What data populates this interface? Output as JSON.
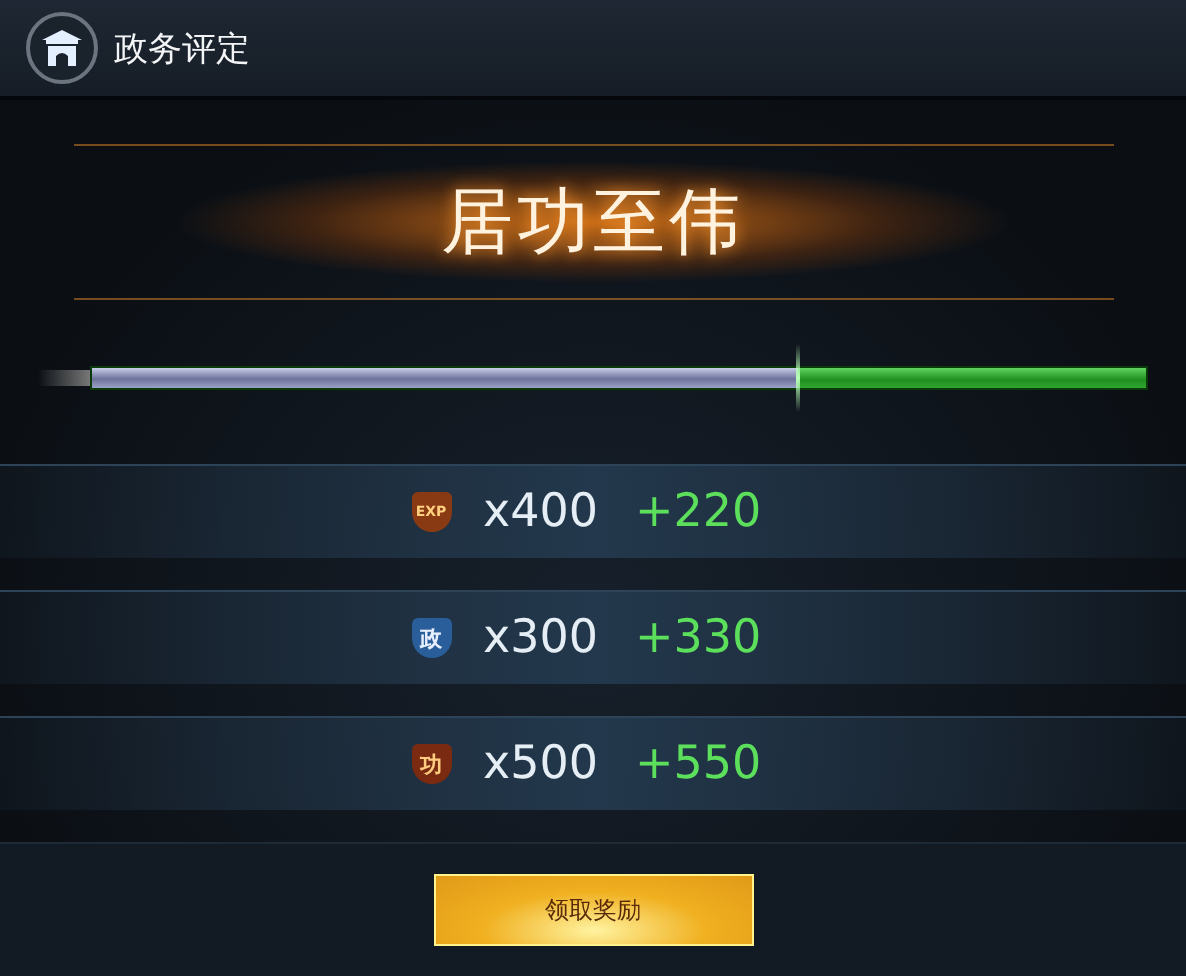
{
  "window": {
    "title": "政务评定"
  },
  "rank": {
    "title": "居功至伟"
  },
  "progress": {
    "level": 0.67
  },
  "rewards": [
    {
      "kind": "exp",
      "emblem": "EXP",
      "amount": "x400",
      "bonus": "+220"
    },
    {
      "kind": "politics",
      "emblem": "政",
      "amount": "x300",
      "bonus": "+330"
    },
    {
      "kind": "merit",
      "emblem": "功",
      "amount": "x500",
      "bonus": "+550"
    }
  ],
  "claim_button": {
    "label": "领取奖励"
  }
}
